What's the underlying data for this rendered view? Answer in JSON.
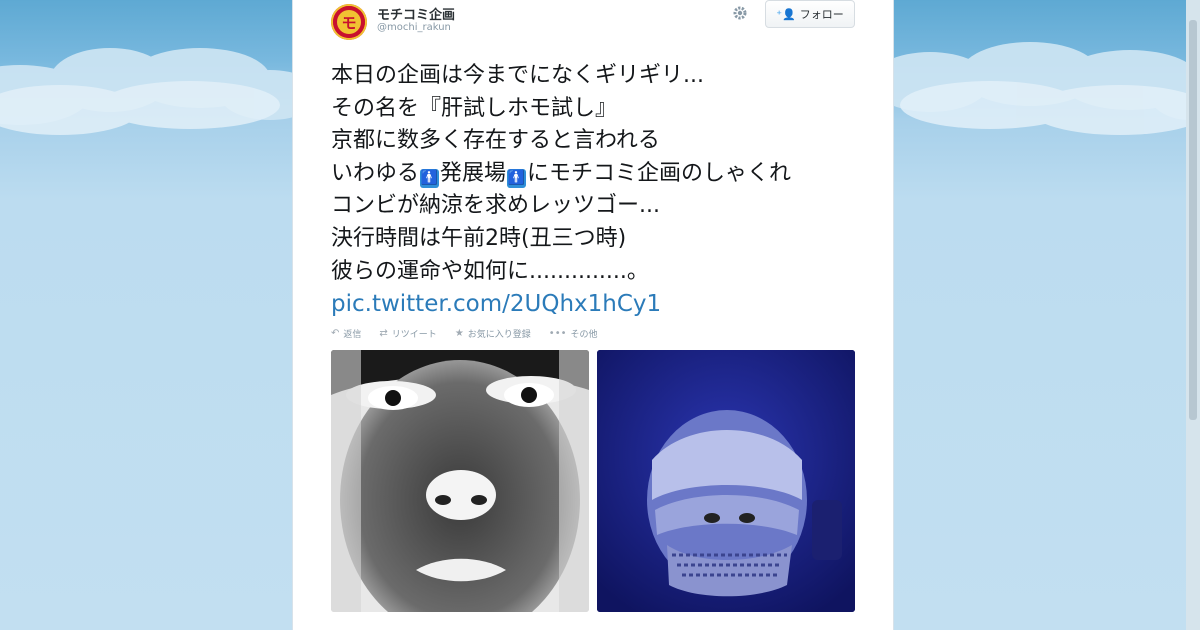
{
  "user": {
    "name": "モチコミ企画",
    "handle": "@mochi_rakun",
    "avatar_label": "モ"
  },
  "follow_button": {
    "label": "フォロー",
    "icon": "follow-user-icon"
  },
  "settings": {
    "icon": "gear-icon"
  },
  "tweet": {
    "lines": [
      "本日の企画は今までになくギリギリ...",
      "その名を『肝試しホモ試し』",
      "京都に数多く存在すると言われる"
    ],
    "line4": {
      "pre": "いわゆる",
      "icon_a": "🚹",
      "mid": "発展場",
      "icon_b": "🚹",
      "post": "にモチコミ企画のしゃくれ"
    },
    "lines_after": [
      "コンビが納涼を求めレッツゴー...",
      "決行時間は午前2時(丑三つ時)",
      "彼らの運命や如何に..............。"
    ],
    "link": "pic.twitter.com/2UQhx1hCy1"
  },
  "actions": [
    {
      "icon": "reply-icon",
      "label": "返信"
    },
    {
      "icon": "retweet-icon",
      "label": "リツイート"
    },
    {
      "icon": "favorite-icon",
      "label": "お気に入り登録"
    },
    {
      "icon": "more-icon",
      "label": "その他"
    }
  ],
  "colors": {
    "link": "#2b7bb9",
    "sky": "#bcdcf0",
    "avatar": "#c8102e"
  }
}
